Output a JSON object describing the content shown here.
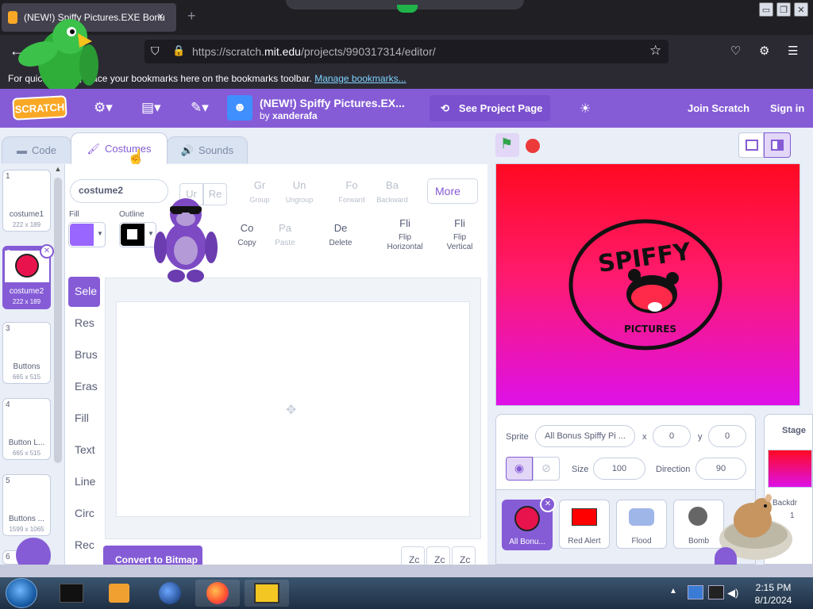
{
  "browser": {
    "tab_title": "(NEW!) Spiffy Pictures.EXE Bonu",
    "tab_close": "×",
    "new_tab": "+",
    "url_domain_pre": "https://scratch.",
    "url_domain": "mit.edu",
    "url_path": "/projects/990317314/editor/",
    "bookmarks_text": "For quick access, place your bookmarks here on the bookmarks toolbar.",
    "bookmarks_link": "Manage bookmarks...",
    "window_buttons": [
      "▭",
      "❐",
      "✕"
    ]
  },
  "menubar": {
    "logo": "SCRATCH",
    "project_title": "(NEW!) Spiffy Pictures.EX...",
    "by_label": "by",
    "author": "xanderafa",
    "see_project": "See Project Page",
    "join": "Join Scratch",
    "sign_in": "Sign in"
  },
  "editor_tabs": {
    "code": "Code",
    "costumes": "Costumes",
    "sounds": "Sounds"
  },
  "costumes": [
    {
      "num": "1",
      "name": "costume1",
      "size": "222 x 189"
    },
    {
      "num": "2",
      "name": "costume2",
      "size": "222 x 189",
      "selected": true
    },
    {
      "num": "3",
      "name": "Buttons",
      "size": "665 x 515"
    },
    {
      "num": "4",
      "name": "Button L...",
      "size": "665 x 515"
    },
    {
      "num": "5",
      "name": "Buttons ...",
      "size": "1599 x 1065"
    },
    {
      "num": "6",
      "name": "",
      "size": ""
    }
  ],
  "paint": {
    "costume_name": "costume2",
    "undo": "Ur",
    "redo": "Re",
    "group_icon": "Gr",
    "group": "Group",
    "ungroup_icon": "Un",
    "ungroup": "Ungroup",
    "forward_icon": "Fo",
    "forward": "Forward",
    "backward_icon": "Ba",
    "backward": "Backward",
    "more": "More",
    "fill_label": "Fill",
    "outline_label": "Outline",
    "fill_color": "#9966ff",
    "outline_color": "#000000",
    "copy_icon": "Co",
    "copy": "Copy",
    "paste_icon": "Pa",
    "paste": "Paste",
    "delete_icon": "De",
    "delete": "Delete",
    "flip_h_icon": "Fli",
    "flip_h": "Flip Horizontal",
    "flip_v_icon": "Fli",
    "flip_v": "Flip Vertical",
    "tools": [
      "Sele",
      "Res",
      "Brus",
      "Eras",
      "Fill",
      "Text",
      "Line",
      "Circ",
      "Rec"
    ],
    "convert": "Convert to Bitmap",
    "zoom": [
      "Zc",
      "Zc",
      "Zc"
    ]
  },
  "sprite": {
    "sprite_label": "Sprite",
    "sprite_name": "All Bonus Spiffy Pi ...",
    "x_label": "x",
    "x": "0",
    "y_label": "y",
    "y": "0",
    "size_label": "Size",
    "size": "100",
    "direction_label": "Direction",
    "direction": "90",
    "list": [
      {
        "name": "All Bonu...",
        "selected": true
      },
      {
        "name": "Red Alert"
      },
      {
        "name": "Flood"
      },
      {
        "name": "Bomb"
      }
    ]
  },
  "stage_panel": {
    "title": "Stage",
    "backdrops_label": "Backdr",
    "backdrops_count": "1"
  },
  "stage_logo": {
    "word1": "SPIFFY",
    "word2": "PICTURES"
  },
  "taskbar": {
    "time": "2:15 PM",
    "date": "8/1/2024"
  }
}
